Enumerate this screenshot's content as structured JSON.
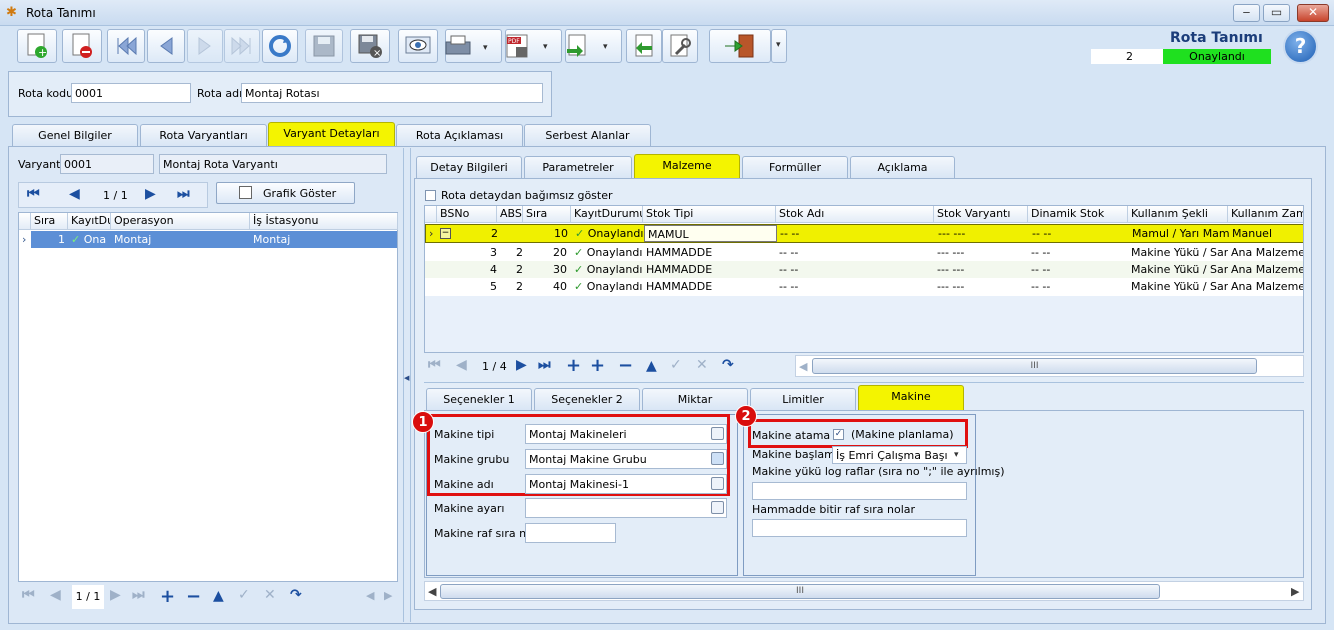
{
  "window": {
    "title": "Rota Tanımı"
  },
  "header": {
    "title": "Rota Tanımı",
    "count": "2",
    "status": "Onaylandı",
    "status_color": "#1fe01f"
  },
  "top": {
    "code_label": "Rota kodu",
    "code_value": "0001",
    "name_label": "Rota adı",
    "name_value": "Montaj Rotası"
  },
  "main_tabs": [
    "Genel Bilgiler",
    "Rota Varyantları",
    "Varyant Detayları",
    "Rota Açıklaması",
    "Serbest Alanlar"
  ],
  "left": {
    "variant_label": "Varyant",
    "variant_code": "0001",
    "variant_name": "Montaj Rota Varyantı",
    "pager": "1 / 1",
    "graph_button": "Grafik Göster",
    "columns": [
      "Sıra",
      "KayıtDu",
      "Operasyon",
      "İş İstasyonu"
    ],
    "row": {
      "sira": "1",
      "status": "Ona",
      "operasyon": "Montaj",
      "istasyon": "Montaj"
    },
    "bottom_pager": "1 / 1"
  },
  "detail_tabs": [
    "Detay Bilgileri",
    "Parametreler",
    "Malzeme",
    "Formüller",
    "Açıklama"
  ],
  "material": {
    "checkbox_label": "Rota detaydan bağımsız göster",
    "columns": [
      "BSNo",
      "ABSI",
      "Sıra",
      "KayıtDurumu",
      "Stok Tipi",
      "Stok Adı",
      "Stok Varyantı",
      "Dinamik Stok",
      "Kullanım Şekli",
      "Kullanım Zaman"
    ],
    "rows": [
      {
        "bsno": "2",
        "absi": "",
        "sira": "10",
        "status": "Onaylandı",
        "tip": "MAMUL",
        "ad": "-- --",
        "varyant": "--- ---",
        "dinamik": "-- --",
        "sekil": "Mamul / Yarı Mamul",
        "zaman": "Manuel"
      },
      {
        "bsno": "3",
        "absi": "2",
        "sira": "20",
        "status": "Onaylandı",
        "tip": "HAMMADDE",
        "ad": "-- --",
        "varyant": "--- ---",
        "dinamik": "-- --",
        "sekil": "Makine Yükü / Sarf",
        "zaman": "Ana Malzeme İş"
      },
      {
        "bsno": "4",
        "absi": "2",
        "sira": "30",
        "status": "Onaylandı",
        "tip": "HAMMADDE",
        "ad": "-- --",
        "varyant": "--- ---",
        "dinamik": "-- --",
        "sekil": "Makine Yükü / Sarf",
        "zaman": "Ana Malzeme İş"
      },
      {
        "bsno": "5",
        "absi": "2",
        "sira": "40",
        "status": "Onaylandı",
        "tip": "HAMMADDE",
        "ad": "-- --",
        "varyant": "--- ---",
        "dinamik": "-- --",
        "sekil": "Makine Yükü / Sarf",
        "zaman": "Ana Malzeme İş"
      }
    ],
    "pager": "1 / 4"
  },
  "sub_tabs": [
    "Seçenekler 1",
    "Seçenekler 2",
    "Miktar",
    "Limitler",
    "Makine"
  ],
  "machine": {
    "type_label": "Makine tipi",
    "type_value": "Montaj Makineleri",
    "group_label": "Makine grubu",
    "group_value": "Montaj Makine Grubu",
    "name_label": "Makine adı",
    "name_value": "Montaj Makinesi-1",
    "setting_label": "Makine ayarı",
    "setting_value": "",
    "shelf_label": "Makine raf sıra no",
    "shelf_value": "",
    "assign_label": "Makine atama",
    "assign_text": "(Makine planlama)",
    "start_label": "Makine başlama",
    "start_value": "İş Emri Çalışma Başı",
    "log_label": "Makine yükü log raflar (sıra no \";\" ile ayrılmış)",
    "log_value": "",
    "finish_label": "Hammadde bitir raf sıra nolar",
    "finish_value": ""
  },
  "badges": {
    "one": "1",
    "two": "2"
  }
}
